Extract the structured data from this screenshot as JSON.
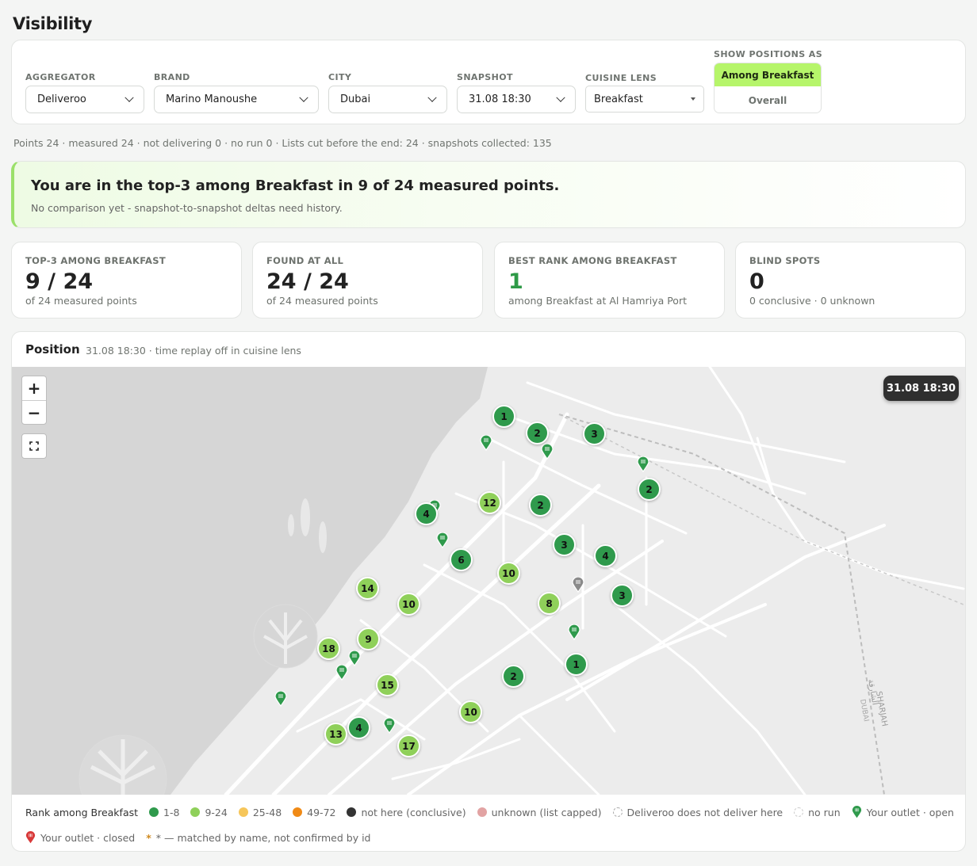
{
  "page": {
    "title": "Visibility"
  },
  "filters": {
    "aggregator": {
      "label": "AGGREGATOR",
      "value": "Deliveroo"
    },
    "brand": {
      "label": "BRAND",
      "value": "Marino Manoushe"
    },
    "city": {
      "label": "CITY",
      "value": "Dubai"
    },
    "snapshot": {
      "label": "SNAPSHOT",
      "value": "31.08 18:30"
    },
    "cuisine_lens": {
      "label": "CUISINE LENS",
      "value": "Breakfast"
    },
    "show_positions": {
      "label": "SHOW POSITIONS AS",
      "options": [
        "Among Breakfast",
        "Overall"
      ],
      "selected": "Among Breakfast"
    }
  },
  "stats_line": "Points 24 · measured 24 · not delivering 0 · no run 0 · Lists cut before the end: 24 · snapshots collected: 135",
  "banner": {
    "title": "You are in the top-3 among Breakfast in 9 of 24 measured points.",
    "subtitle": "No comparison yet - snapshot-to-snapshot deltas need history."
  },
  "kpis": [
    {
      "label": "TOP-3 AMONG BREAKFAST",
      "value": "9 / 24",
      "sub": "of 24 measured points"
    },
    {
      "label": "FOUND AT ALL",
      "value": "24 / 24",
      "sub": "of 24 measured points"
    },
    {
      "label": "BEST RANK AMONG BREAKFAST",
      "value": "1",
      "sub": "among Breakfast at Al Hamriya Port"
    },
    {
      "label": "BLIND SPOTS",
      "value": "0",
      "sub": "0 conclusive · 0 unknown"
    }
  ],
  "position": {
    "title": "Position",
    "subtitle": "31.08 18:30 · time replay off in cuisine lens",
    "time_pill": "31.08 18:30",
    "zoom_in": "+",
    "zoom_out": "−",
    "map_label": "SHARJAH",
    "map_label_ar": "الشارقة",
    "map_label_dubai": "DUBAI",
    "ranks": [
      {
        "rank": "1",
        "tier": "dark"
      },
      {
        "rank": "2",
        "tier": "dark"
      },
      {
        "rank": "3",
        "tier": "dark"
      },
      {
        "rank": "2",
        "tier": "dark"
      },
      {
        "rank": "12",
        "tier": "light"
      },
      {
        "rank": "2",
        "tier": "dark"
      },
      {
        "rank": "4",
        "tier": "dark"
      },
      {
        "rank": "3",
        "tier": "dark"
      },
      {
        "rank": "4",
        "tier": "dark"
      },
      {
        "rank": "6",
        "tier": "dark"
      },
      {
        "rank": "10",
        "tier": "light"
      },
      {
        "rank": "14",
        "tier": "light"
      },
      {
        "rank": "10",
        "tier": "light"
      },
      {
        "rank": "8",
        "tier": "light"
      },
      {
        "rank": "3",
        "tier": "dark"
      },
      {
        "rank": "9",
        "tier": "light"
      },
      {
        "rank": "18",
        "tier": "light"
      },
      {
        "rank": "1",
        "tier": "dark"
      },
      {
        "rank": "15",
        "tier": "light"
      },
      {
        "rank": "2",
        "tier": "dark"
      },
      {
        "rank": "10",
        "tier": "light"
      },
      {
        "rank": "4",
        "tier": "dark"
      },
      {
        "rank": "13",
        "tier": "light"
      },
      {
        "rank": "17",
        "tier": "light"
      }
    ]
  },
  "legend": {
    "title": "Rank among Breakfast",
    "tier_1_8": "1-8",
    "tier_9_24": "9-24",
    "tier_25_48": "25-48",
    "tier_49_72": "49-72",
    "not_here": "not here (conclusive)",
    "unknown": "unknown (list capped)",
    "no_deliver": "Deliveroo does not deliver here",
    "no_run": "no run",
    "outlet_open": "Your outlet · open",
    "outlet_closed": "Your outlet · closed",
    "asterisk": "*",
    "matched": "* — matched by name, not confirmed by id"
  },
  "colors": {
    "tier_1_8": "#2f9a4c",
    "tier_9_24": "#8fd05a",
    "tier_25_48": "#f6c65a",
    "tier_49_72": "#f08a16",
    "not_here": "#333333",
    "unknown": "#e2a3a3",
    "accent": "#b6f56a"
  }
}
